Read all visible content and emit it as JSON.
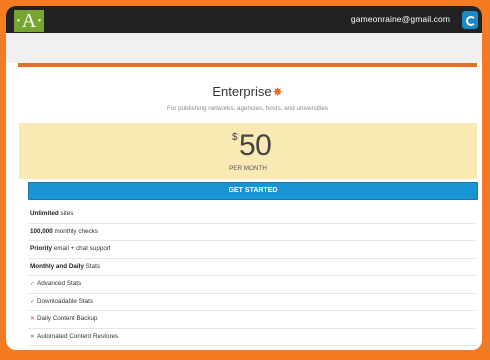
{
  "header": {
    "logo_text": "·A·",
    "account_email": "gameonraine@gmail.com"
  },
  "plan": {
    "name": "Enterprise",
    "badge_icon": "gear-icon",
    "tagline": "For publishing networks, agencies, hosts, and universities",
    "currency_symbol": "$",
    "price": "50",
    "period": "PER MONTH",
    "cta_label": "GET STARTED"
  },
  "features": [
    {
      "bold": "Unlimited",
      "text": " sites",
      "mark": ""
    },
    {
      "bold": "100,000",
      "text": " monthly checks",
      "mark": ""
    },
    {
      "bold": "Priority",
      "text": " email + chat support",
      "mark": ""
    },
    {
      "bold": "Monthly and Daily",
      "text": " Stats",
      "mark": ""
    },
    {
      "bold": "",
      "text": "Advanced Stats",
      "mark": "check"
    },
    {
      "bold": "",
      "text": "Downloadable Stats",
      "mark": "check"
    },
    {
      "bold": "",
      "text": "Daily Content Backup",
      "mark": "cross"
    },
    {
      "bold": "",
      "text": "Automated Content Restores",
      "mark": "cross"
    }
  ],
  "colors": {
    "accent_orange": "#e66e24",
    "price_panel": "#fbe9b4",
    "cta_blue": "#1a95d3",
    "logo_green": "#76a531"
  }
}
